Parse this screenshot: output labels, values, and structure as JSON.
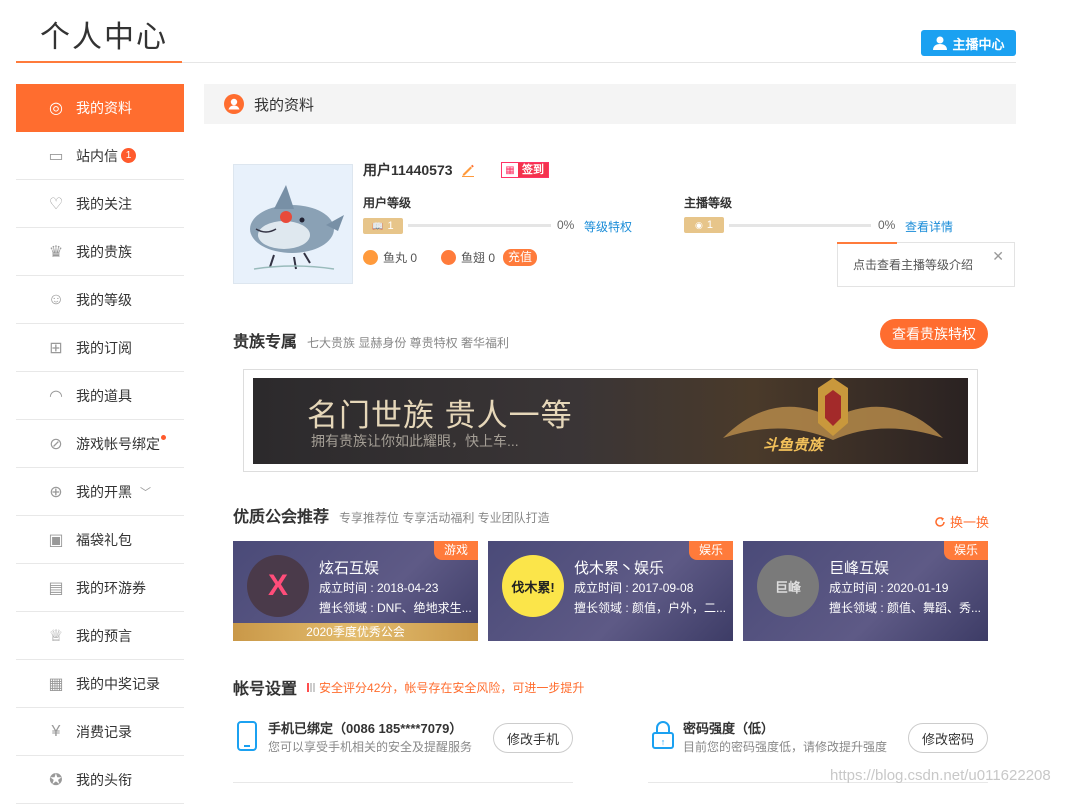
{
  "header": {
    "title": "个人中心",
    "anchor_center": "主播中心"
  },
  "sidebar": {
    "items": [
      {
        "label": "我的资料",
        "icon": "user-circle-icon",
        "active": true
      },
      {
        "label": "站内信",
        "icon": "message-icon",
        "badge": "1"
      },
      {
        "label": "我的关注",
        "icon": "heart-icon"
      },
      {
        "label": "我的贵族",
        "icon": "crown-icon"
      },
      {
        "label": "我的等级",
        "icon": "level-icon"
      },
      {
        "label": "我的订阅",
        "icon": "bookmark-icon"
      },
      {
        "label": "我的道具",
        "icon": "bag-icon"
      },
      {
        "label": "游戏帐号绑定",
        "icon": "link-icon",
        "dot": true
      },
      {
        "label": "我的开黑",
        "icon": "gamepad-icon",
        "expand": true
      },
      {
        "label": "福袋礼包",
        "icon": "gift-bag-icon"
      },
      {
        "label": "我的环游券",
        "icon": "ticket-icon"
      },
      {
        "label": "我的预言",
        "icon": "trophy-icon"
      },
      {
        "label": "我的中奖记录",
        "icon": "record-icon"
      },
      {
        "label": "消费记录",
        "icon": "yuan-icon"
      },
      {
        "label": "我的头衔",
        "icon": "medal-icon"
      }
    ]
  },
  "profile": {
    "section_title": "我的资料",
    "username": "用户11440573",
    "signin": "签到",
    "user_level": {
      "title": "用户等级",
      "level": "1",
      "percent": "0%",
      "progress": 0,
      "link": "等级特权"
    },
    "anchor_level": {
      "title": "主播等级",
      "level": "1",
      "percent": "0%",
      "progress": 0,
      "link": "查看详情"
    },
    "yuwan": "鱼丸 0",
    "yuchi": "鱼翅 0",
    "recharge": "充值",
    "tooltip": "点击查看主播等级介绍"
  },
  "noble": {
    "title": "贵族专属",
    "subtitle": "七大贵族 显赫身份 尊贵特权 奢华福利",
    "button": "查看贵族特权",
    "banner_title": "名门世族 贵人一等",
    "banner_sub": "拥有贵族让你如此耀眼，快上车...",
    "banner_logo": "斗鱼贵族"
  },
  "guilds": {
    "title": "优质公会推荐",
    "subtitle": "专享推荐位 专享活动福利 专业团队打造",
    "refresh": "换一换",
    "items": [
      {
        "tag": "游戏",
        "name": "炫石互娱",
        "founded": "成立时间 : 2018-04-23",
        "field": "擅长领域 : DNF、绝地求生...",
        "award": "2020季度优秀公会",
        "logo": "X"
      },
      {
        "tag": "娱乐",
        "name": "伐木累丶娱乐",
        "founded": "成立时间 : 2017-09-08",
        "field": "擅长领域 : 颜值，户外，二...",
        "logo": "伐木累!"
      },
      {
        "tag": "娱乐",
        "name": "巨峰互娱",
        "founded": "成立时间 : 2020-01-19",
        "field": "擅长领域 : 颜值、舞蹈、秀...",
        "logo": "巨峰"
      }
    ]
  },
  "account": {
    "title": "帐号设置",
    "warning": "安全评分42分，帐号存在安全风险，可进一步提升",
    "phone": {
      "title": "手机已绑定（0086 185****7079）",
      "desc": "您可以享受手机相关的安全及提醒服务",
      "button": "修改手机"
    },
    "password": {
      "title": "密码强度（低）",
      "desc": "目前您的密码强度低，请修改提升强度",
      "button": "修改密码"
    }
  },
  "watermark": "https://blog.csdn.net/u011622208",
  "colors": {
    "accent": "#ff6d2f",
    "link": "#1a8cd8",
    "anchor_btn": "#1ba1f1"
  }
}
